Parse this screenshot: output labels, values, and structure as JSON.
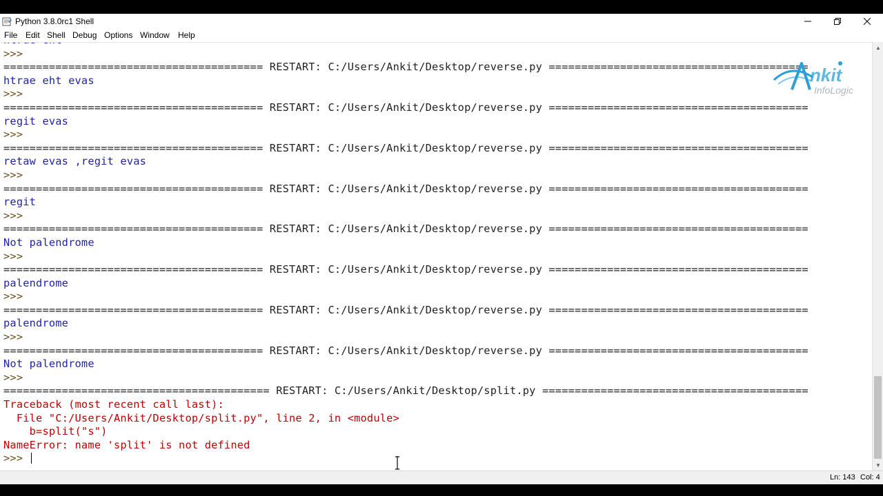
{
  "window": {
    "title": "Python 3.8.0rc1 Shell",
    "controls": {
      "minimize_icon": "minimize-icon",
      "restore_icon": "restore-icon",
      "close_icon": "close-icon"
    }
  },
  "menu": [
    "File",
    "Edit",
    "Shell",
    "Debug",
    "Options",
    "Window",
    "Help"
  ],
  "shell_lines": [
    {
      "text": "htrae eht",
      "kind": "out"
    },
    {
      "text": ">>> ",
      "kind": "prompt"
    },
    {
      "text": "======================================== RESTART: C:/Users/Ankit/Desktop/reverse.py ========================================",
      "kind": "restart"
    },
    {
      "text": "htrae eht evas",
      "kind": "out"
    },
    {
      "text": ">>> ",
      "kind": "prompt"
    },
    {
      "text": "======================================== RESTART: C:/Users/Ankit/Desktop/reverse.py ========================================",
      "kind": "restart"
    },
    {
      "text": "regit evas",
      "kind": "out"
    },
    {
      "text": ">>> ",
      "kind": "prompt"
    },
    {
      "text": "======================================== RESTART: C:/Users/Ankit/Desktop/reverse.py ========================================",
      "kind": "restart"
    },
    {
      "text": "retaw evas ,regit evas",
      "kind": "out"
    },
    {
      "text": ">>> ",
      "kind": "prompt"
    },
    {
      "text": "======================================== RESTART: C:/Users/Ankit/Desktop/reverse.py ========================================",
      "kind": "restart"
    },
    {
      "text": "regit",
      "kind": "out"
    },
    {
      "text": ">>> ",
      "kind": "prompt"
    },
    {
      "text": "======================================== RESTART: C:/Users/Ankit/Desktop/reverse.py ========================================",
      "kind": "restart"
    },
    {
      "text": "Not palendrome",
      "kind": "out"
    },
    {
      "text": ">>> ",
      "kind": "prompt"
    },
    {
      "text": "======================================== RESTART: C:/Users/Ankit/Desktop/reverse.py ========================================",
      "kind": "restart"
    },
    {
      "text": "palendrome",
      "kind": "out"
    },
    {
      "text": ">>> ",
      "kind": "prompt"
    },
    {
      "text": "======================================== RESTART: C:/Users/Ankit/Desktop/reverse.py ========================================",
      "kind": "restart"
    },
    {
      "text": "palendrome",
      "kind": "out"
    },
    {
      "text": ">>> ",
      "kind": "prompt"
    },
    {
      "text": "======================================== RESTART: C:/Users/Ankit/Desktop/reverse.py ========================================",
      "kind": "restart"
    },
    {
      "text": "Not palendrome",
      "kind": "out"
    },
    {
      "text": ">>> ",
      "kind": "prompt"
    },
    {
      "text": "========================================= RESTART: C:/Users/Ankit/Desktop/split.py =========================================",
      "kind": "restart"
    },
    {
      "text": "Traceback (most recent call last):",
      "kind": "err"
    },
    {
      "text": "  File \"C:/Users/Ankit/Desktop/split.py\", line 2, in <module>",
      "kind": "err"
    },
    {
      "text": "    b=split(\"s\")",
      "kind": "err"
    },
    {
      "text": "NameError: name 'split' is not defined",
      "kind": "err"
    },
    {
      "text": ">>> ",
      "kind": "prompt",
      "cursor": true
    }
  ],
  "status": {
    "ln": "Ln: 143",
    "col": "Col: 4"
  },
  "logo": {
    "word": "nkit",
    "tag": "InfoLogic",
    "accent": "#2a9fd8"
  },
  "colors": {
    "prompt": "#6b4f1d",
    "output": "#1f24a6",
    "error": "#c00000"
  }
}
